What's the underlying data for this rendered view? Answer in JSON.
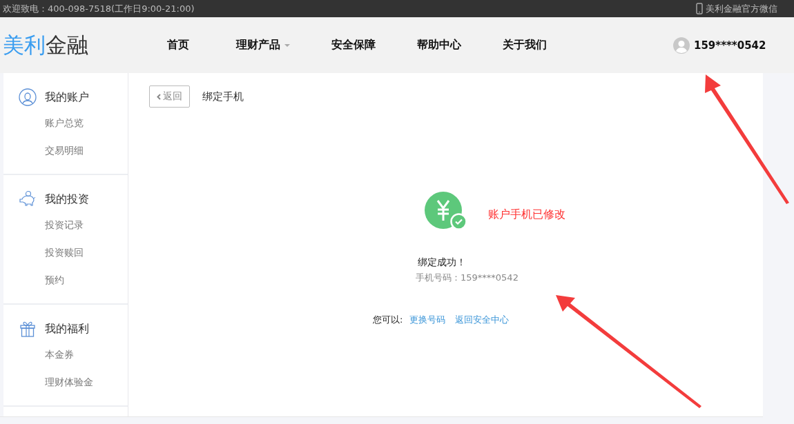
{
  "top_bar": {
    "hotline": "欢迎致电：400-098-7518(工作日9:00-21:00)",
    "wechat": "美利金融官方微信"
  },
  "header": {
    "logo_part_1": "美利",
    "logo_part_2": "金融",
    "nav": [
      {
        "label": "首页",
        "dropdown": false
      },
      {
        "label": "理财产品",
        "dropdown": true
      },
      {
        "label": "安全保障",
        "dropdown": false
      },
      {
        "label": "帮助中心",
        "dropdown": false
      },
      {
        "label": "关于我们",
        "dropdown": false
      }
    ],
    "user": "159****0542"
  },
  "sidebar": [
    {
      "kind": "account",
      "title": "我的账户",
      "items": [
        "账户总览",
        "交易明细"
      ]
    },
    {
      "kind": "invest",
      "title": "我的投资",
      "items": [
        "投资记录",
        "投资赎回",
        "预约"
      ]
    },
    {
      "kind": "gift",
      "title": "我的福利",
      "items": [
        "本金券",
        "理财体验金"
      ]
    }
  ],
  "content": {
    "back": "返回",
    "title": "绑定手机",
    "annotation": "账户手机已修改",
    "success": "绑定成功！",
    "phone": "手机号码：159****0542",
    "prompt": "您可以:",
    "links": [
      "更换号码",
      "返回安全中心"
    ]
  }
}
